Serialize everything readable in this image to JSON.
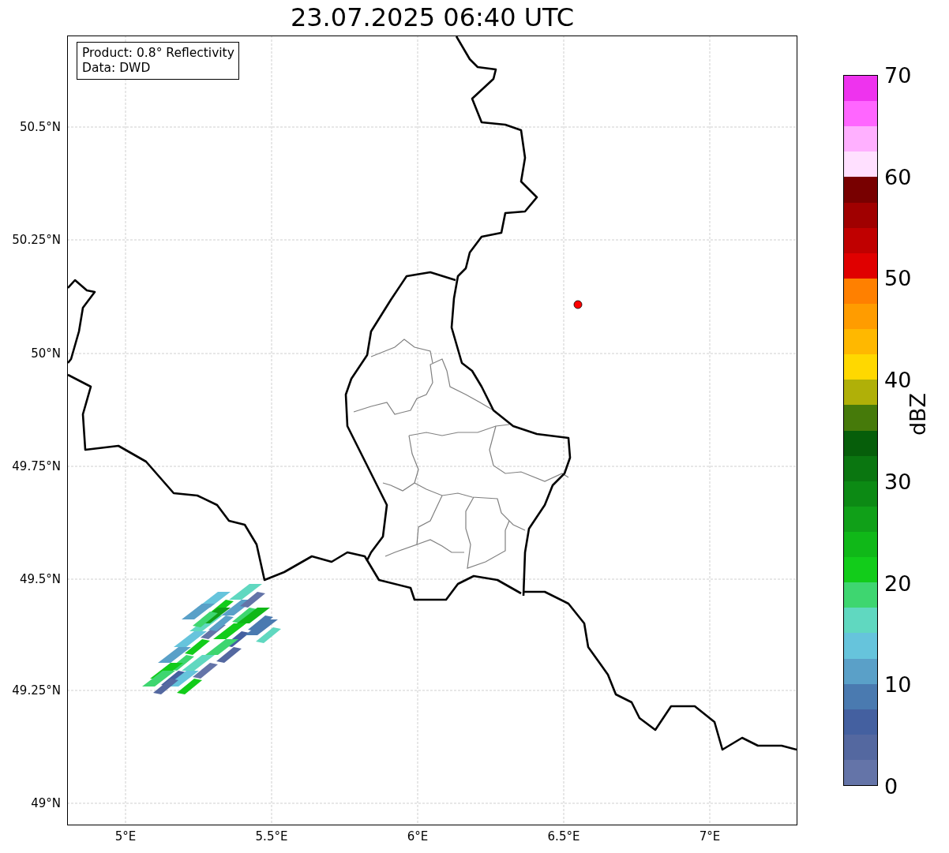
{
  "title": "23.07.2025 06:40 UTC",
  "legend": [
    "Product: 0.8° Reflectivity",
    "Data: DWD"
  ],
  "map": {
    "kind": "map",
    "marker": {
      "color": "#ff0000"
    },
    "yticks": [
      "50.5°N",
      "50.25°N",
      "50°N",
      "49.75°N",
      "49.5°N",
      "49.25°N",
      "49°N"
    ],
    "xticks": [
      "5°E",
      "5.5°E",
      "6°E",
      "6.5°E",
      "7°E"
    ]
  },
  "colorbar": {
    "label": "dBZ",
    "ticks": [
      "70",
      "60",
      "50",
      "40",
      "30",
      "20",
      "10",
      "0"
    ],
    "bands": [
      {
        "color": "#ee33ee"
      },
      {
        "color": "#ff66ff"
      },
      {
        "color": "#ffb0ff"
      },
      {
        "color": "#ffe0ff"
      },
      {
        "color": "#780000"
      },
      {
        "color": "#a00000"
      },
      {
        "color": "#c00000"
      },
      {
        "color": "#e00000"
      },
      {
        "color": "#ff8000"
      },
      {
        "color": "#ff9c00"
      },
      {
        "color": "#ffb800"
      },
      {
        "color": "#ffd800"
      },
      {
        "color": "#b0b008"
      },
      {
        "color": "#467a0a"
      },
      {
        "color": "#065e0a"
      },
      {
        "color": "#0a7610"
      },
      {
        "color": "#0c8a14"
      },
      {
        "color": "#10a018"
      },
      {
        "color": "#10b818"
      },
      {
        "color": "#12cc1a"
      },
      {
        "color": "#3ed670"
      },
      {
        "color": "#60d8c0"
      },
      {
        "color": "#66c4dc"
      },
      {
        "color": "#5aa0c8"
      },
      {
        "color": "#4a7ab0"
      },
      {
        "color": "#4460a0"
      },
      {
        "color": "#5468a0"
      },
      {
        "color": "#6474a8"
      }
    ]
  }
}
